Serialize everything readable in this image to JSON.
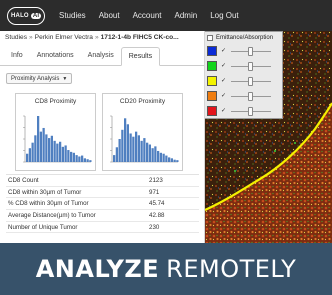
{
  "nav": {
    "logo_text": "HALO",
    "logo_ai": "AI",
    "items": [
      "Studies",
      "About",
      "Account",
      "Admin",
      "Log Out"
    ]
  },
  "breadcrumb": {
    "root": "Studies",
    "study": "Perkin Elmer Vectra",
    "current": "1712-1-4b FIHC5 CK-co..."
  },
  "tabs": [
    "Info",
    "Annotations",
    "Analysis",
    "Results"
  ],
  "active_tab": "Results",
  "dropdown": {
    "label": "Proximity Analysis"
  },
  "charts": [
    {
      "title": "CD8 Proximity"
    },
    {
      "title": "CD20 Proximity"
    }
  ],
  "stats": [
    {
      "label": "CD8 Count",
      "value": "2123"
    },
    {
      "label": "CD8 within 30µm of Tumor",
      "value": "971"
    },
    {
      "label": "% CD8 within 30µm of Tumor",
      "value": "45.74"
    },
    {
      "label": "Average Distance(µm) to Tumor",
      "value": "42.88"
    },
    {
      "label": "Number of Unique Tumor",
      "value": "230"
    }
  ],
  "channel_panel": {
    "title": "Emittance/Absorption",
    "channels": [
      {
        "color": "#0a2bd6",
        "checked": "✓"
      },
      {
        "color": "#12d41b",
        "checked": "✓"
      },
      {
        "color": "#f3f300",
        "checked": "✓"
      },
      {
        "color": "#ef7d10",
        "checked": "✓"
      },
      {
        "color": "#e2141b",
        "checked": "✓"
      }
    ]
  },
  "banner": {
    "bold": "ANALYZE",
    "light": "REMOTELY"
  },
  "histograms": {
    "bar_color": "#4f7fc0",
    "cd8": [
      0.18,
      0.3,
      0.42,
      0.58,
      1.0,
      0.66,
      0.74,
      0.6,
      0.52,
      0.57,
      0.46,
      0.4,
      0.44,
      0.33,
      0.36,
      0.26,
      0.22,
      0.2,
      0.15,
      0.12,
      0.14,
      0.08,
      0.06,
      0.04
    ],
    "cd20": [
      0.15,
      0.32,
      0.5,
      0.7,
      0.95,
      0.82,
      0.62,
      0.55,
      0.66,
      0.58,
      0.46,
      0.52,
      0.42,
      0.38,
      0.3,
      0.34,
      0.24,
      0.2,
      0.18,
      0.14,
      0.1,
      0.08,
      0.05,
      0.04
    ]
  }
}
